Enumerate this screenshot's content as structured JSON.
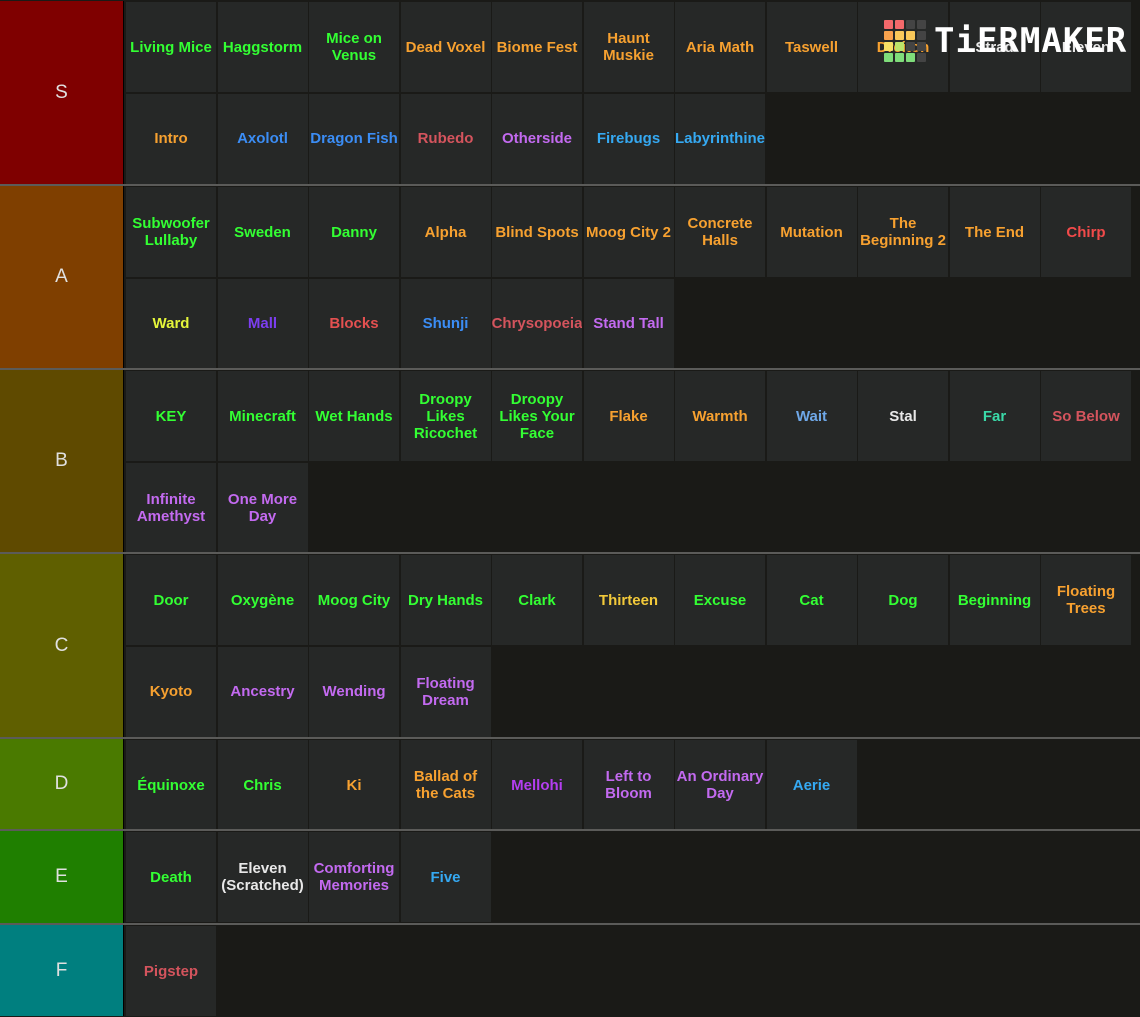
{
  "logo": {
    "text": "TiERMAKER",
    "grid_colors": [
      "#f4696b",
      "#f4696b",
      "#444444",
      "#444444",
      "#f8a24d",
      "#f8c85a",
      "#f8c85a",
      "#444444",
      "#f8e065",
      "#bde46a",
      "#444444",
      "#444444",
      "#7fdd7a",
      "#7fdd7a",
      "#7fdd7a",
      "#444444"
    ]
  },
  "tiers": [
    {
      "label": "S",
      "color": "#7f0000",
      "items": [
        {
          "text": "Living Mice",
          "color": "#33ff33"
        },
        {
          "text": "Haggstorm",
          "color": "#33ff33"
        },
        {
          "text": "Mice on Venus",
          "color": "#33ff33"
        },
        {
          "text": "Dead Voxel",
          "color": "#f7a130"
        },
        {
          "text": "Biome Fest",
          "color": "#f7a130"
        },
        {
          "text": "Haunt Muskie",
          "color": "#f7a130"
        },
        {
          "text": "Aria Math",
          "color": "#f7a130"
        },
        {
          "text": "Taswell",
          "color": "#f7a130"
        },
        {
          "text": "Dreiton",
          "color": "#f7a130"
        },
        {
          "text": "Strad",
          "color": "#e8e8e8"
        },
        {
          "text": "Eleven",
          "color": "#e8e8e8"
        },
        {
          "text": "Intro",
          "color": "#f7a130"
        },
        {
          "text": "Axolotl",
          "color": "#3b8df5"
        },
        {
          "text": "Dragon Fish",
          "color": "#3b8df5"
        },
        {
          "text": "Rubedo",
          "color": "#d4545d"
        },
        {
          "text": "Otherside",
          "color": "#c36af0"
        },
        {
          "text": "Firebugs",
          "color": "#35a9f2"
        },
        {
          "text": "Labyrinthine",
          "color": "#35a9f2"
        }
      ]
    },
    {
      "label": "A",
      "color": "#7f3f00",
      "items": [
        {
          "text": "Subwoofer Lullaby",
          "color": "#33ff33"
        },
        {
          "text": "Sweden",
          "color": "#33ff33"
        },
        {
          "text": "Danny",
          "color": "#33ff33"
        },
        {
          "text": "Alpha",
          "color": "#f7a130"
        },
        {
          "text": "Blind Spots",
          "color": "#f7a130"
        },
        {
          "text": "Moog City 2",
          "color": "#f7a130"
        },
        {
          "text": "Concrete Halls",
          "color": "#f7a130"
        },
        {
          "text": "Mutation",
          "color": "#f7a130"
        },
        {
          "text": "The Beginning 2",
          "color": "#f7a130"
        },
        {
          "text": "The End",
          "color": "#f7a130"
        },
        {
          "text": "Chirp",
          "color": "#f24a4a"
        },
        {
          "text": "Ward",
          "color": "#e4f53a"
        },
        {
          "text": "Mall",
          "color": "#7c3ef0"
        },
        {
          "text": "Blocks",
          "color": "#e45050"
        },
        {
          "text": "Shunji",
          "color": "#3b8df5"
        },
        {
          "text": "Chrysopoeia",
          "color": "#d4545d"
        },
        {
          "text": "Stand Tall",
          "color": "#c36af0"
        }
      ]
    },
    {
      "label": "B",
      "color": "#5f4a00",
      "items": [
        {
          "text": "KEY",
          "color": "#33ff33"
        },
        {
          "text": "Minecraft",
          "color": "#33ff33"
        },
        {
          "text": "Wet Hands",
          "color": "#33ff33"
        },
        {
          "text": "Droopy Likes Ricochet",
          "color": "#33ff33"
        },
        {
          "text": "Droopy Likes Your Face",
          "color": "#33ff33"
        },
        {
          "text": "Flake",
          "color": "#f7a130"
        },
        {
          "text": "Warmth",
          "color": "#f7a130"
        },
        {
          "text": "Wait",
          "color": "#6fa8e8"
        },
        {
          "text": "Stal",
          "color": "#e8e8e8"
        },
        {
          "text": "Far",
          "color": "#3ad9a8"
        },
        {
          "text": "So Below",
          "color": "#d4545d"
        },
        {
          "text": "Infinite Amethyst",
          "color": "#c36af0"
        },
        {
          "text": "One More Day",
          "color": "#c36af0"
        }
      ]
    },
    {
      "label": "C",
      "color": "#5f5f00",
      "items": [
        {
          "text": "Door",
          "color": "#33ff33"
        },
        {
          "text": "Oxygène",
          "color": "#33ff33"
        },
        {
          "text": "Moog City",
          "color": "#33ff33"
        },
        {
          "text": "Dry Hands",
          "color": "#33ff33"
        },
        {
          "text": "Clark",
          "color": "#33ff33"
        },
        {
          "text": "Thirteen",
          "color": "#f2c93a"
        },
        {
          "text": "Excuse",
          "color": "#33ff33"
        },
        {
          "text": "Cat",
          "color": "#33ff33"
        },
        {
          "text": "Dog",
          "color": "#33ff33"
        },
        {
          "text": "Beginning",
          "color": "#33ff33"
        },
        {
          "text": "Floating Trees",
          "color": "#f7a130"
        },
        {
          "text": "Kyoto",
          "color": "#f7a130"
        },
        {
          "text": "Ancestry",
          "color": "#c36af0"
        },
        {
          "text": "Wending",
          "color": "#c36af0"
        },
        {
          "text": "Floating Dream",
          "color": "#c36af0"
        }
      ]
    },
    {
      "label": "D",
      "color": "#4a7a00",
      "items": [
        {
          "text": "Équinoxe",
          "color": "#33ff33"
        },
        {
          "text": "Chris",
          "color": "#33ff33"
        },
        {
          "text": "Ki",
          "color": "#f7a130"
        },
        {
          "text": "Ballad of the Cats",
          "color": "#f7a130"
        },
        {
          "text": "Mellohi",
          "color": "#b43ef0"
        },
        {
          "text": "Left to Bloom",
          "color": "#c36af0"
        },
        {
          "text": "An Ordinary Day",
          "color": "#c36af0"
        },
        {
          "text": "Aerie",
          "color": "#35a9f2"
        }
      ]
    },
    {
      "label": "E",
      "color": "#1f7f00",
      "items": [
        {
          "text": "Death",
          "color": "#33ff33"
        },
        {
          "text": "Eleven (Scratched)",
          "color": "#e8e8e8"
        },
        {
          "text": "Comforting Memories",
          "color": "#c36af0"
        },
        {
          "text": "Five",
          "color": "#35a9f2"
        }
      ]
    },
    {
      "label": "F",
      "color": "#007f7f",
      "items": [
        {
          "text": "Pigstep",
          "color": "#d4545d"
        }
      ]
    }
  ]
}
